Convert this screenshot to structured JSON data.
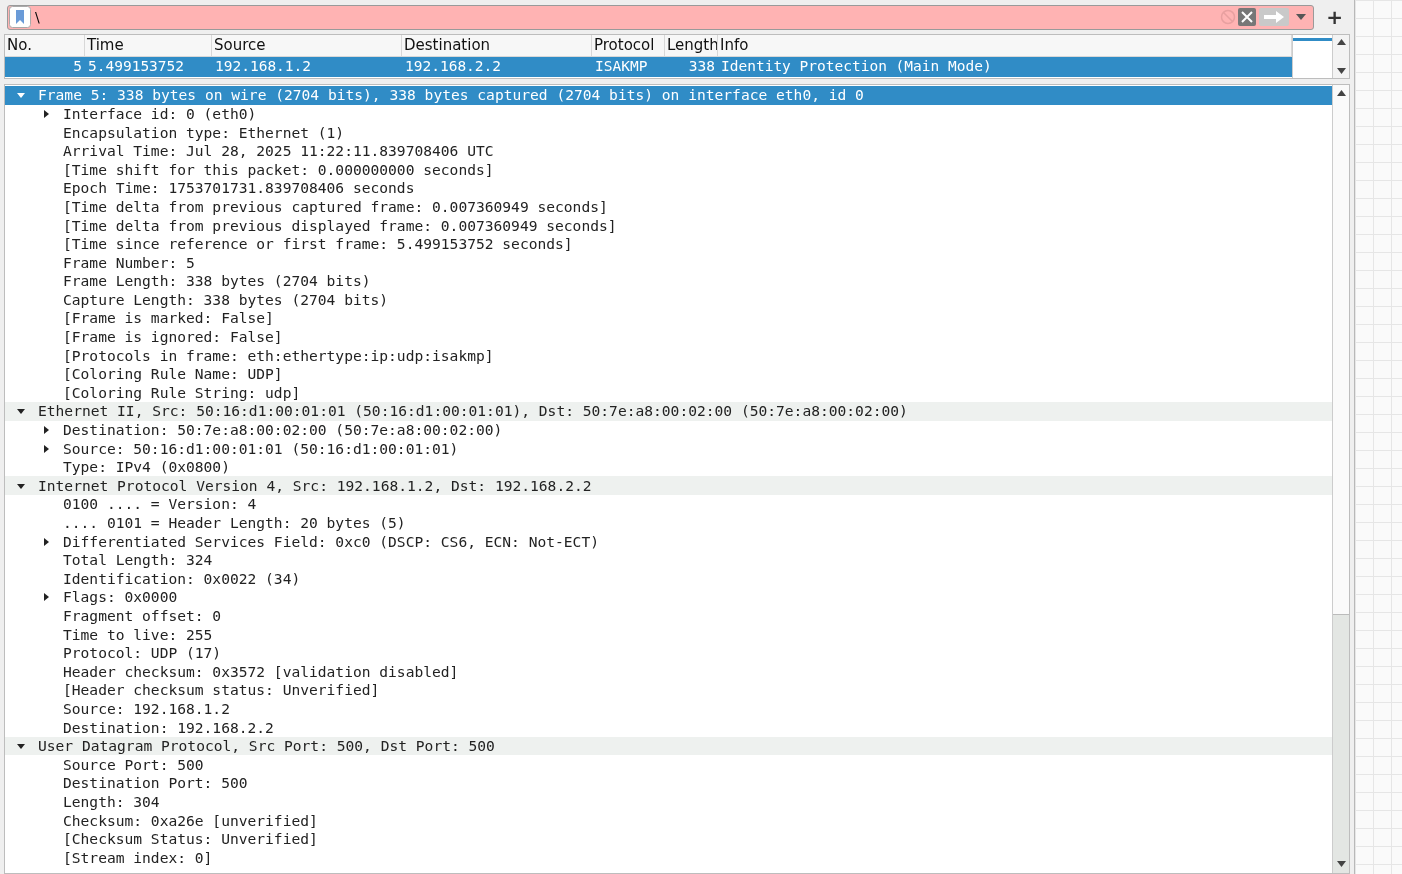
{
  "filter": {
    "value": "\\",
    "invalid": true,
    "plus": "+"
  },
  "packet_list": {
    "columns": [
      "No.",
      "Time",
      "Source",
      "Destination",
      "Protocol",
      "Length",
      "Info"
    ],
    "rows": [
      {
        "selected": true,
        "cells": [
          "5",
          "5.499153752",
          "192.168.1.2",
          "192.168.2.2",
          "ISAKMP",
          "338",
          "Identity Protection (Main Mode)"
        ]
      }
    ]
  },
  "details": [
    {
      "text": "Frame 5: 338 bytes on wire (2704 bits), 338 bytes captured (2704 bits) on interface eth0, id 0",
      "expanded": true,
      "selected": true,
      "children": [
        {
          "text": "Interface id: 0 (eth0)",
          "expanded": false,
          "selected": false
        },
        {
          "text": "Encapsulation type: Ethernet (1)",
          "selected": false
        },
        {
          "text": "Arrival Time: Jul 28, 2025 11:22:11.839708406 UTC",
          "selected": false
        },
        {
          "text": "[Time shift for this packet: 0.000000000 seconds]",
          "selected": false
        },
        {
          "text": "Epoch Time: 1753701731.839708406 seconds",
          "selected": false
        },
        {
          "text": "[Time delta from previous captured frame: 0.007360949 seconds]",
          "selected": false
        },
        {
          "text": "[Time delta from previous displayed frame: 0.007360949 seconds]",
          "selected": false
        },
        {
          "text": "[Time since reference or first frame: 5.499153752 seconds]",
          "selected": false
        },
        {
          "text": "Frame Number: 5",
          "selected": false
        },
        {
          "text": "Frame Length: 338 bytes (2704 bits)",
          "selected": false
        },
        {
          "text": "Capture Length: 338 bytes (2704 bits)",
          "selected": false
        },
        {
          "text": "[Frame is marked: False]",
          "selected": false
        },
        {
          "text": "[Frame is ignored: False]",
          "selected": false
        },
        {
          "text": "[Protocols in frame: eth:ethertype:ip:udp:isakmp]",
          "selected": false
        },
        {
          "text": "[Coloring Rule Name: UDP]",
          "selected": false
        },
        {
          "text": "[Coloring Rule String: udp]",
          "selected": false
        }
      ]
    },
    {
      "text": "Ethernet II, Src: 50:16:d1:00:01:01 (50:16:d1:00:01:01), Dst: 50:7e:a8:00:02:00 (50:7e:a8:00:02:00)",
      "expanded": true,
      "selected": false,
      "children": [
        {
          "text": "Destination: 50:7e:a8:00:02:00 (50:7e:a8:00:02:00)",
          "expanded": false,
          "selected": false
        },
        {
          "text": "Source: 50:16:d1:00:01:01 (50:16:d1:00:01:01)",
          "expanded": false,
          "selected": false
        },
        {
          "text": "Type: IPv4 (0x0800)",
          "selected": false
        }
      ]
    },
    {
      "text": "Internet Protocol Version 4, Src: 192.168.1.2, Dst: 192.168.2.2",
      "expanded": true,
      "selected": false,
      "children": [
        {
          "text": "0100 .... = Version: 4",
          "selected": false
        },
        {
          "text": ".... 0101 = Header Length: 20 bytes (5)",
          "selected": false
        },
        {
          "text": "Differentiated Services Field: 0xc0 (DSCP: CS6, ECN: Not-ECT)",
          "expanded": false,
          "selected": false
        },
        {
          "text": "Total Length: 324",
          "selected": false
        },
        {
          "text": "Identification: 0x0022 (34)",
          "selected": false
        },
        {
          "text": "Flags: 0x0000",
          "expanded": false,
          "selected": false
        },
        {
          "text": "Fragment offset: 0",
          "selected": false
        },
        {
          "text": "Time to live: 255",
          "selected": false
        },
        {
          "text": "Protocol: UDP (17)",
          "selected": false
        },
        {
          "text": "Header checksum: 0x3572 [validation disabled]",
          "selected": false
        },
        {
          "text": "[Header checksum status: Unverified]",
          "selected": false
        },
        {
          "text": "Source: 192.168.1.2",
          "selected": false
        },
        {
          "text": "Destination: 192.168.2.2",
          "selected": false
        }
      ]
    },
    {
      "text": "User Datagram Protocol, Src Port: 500, Dst Port: 500",
      "expanded": true,
      "selected": false,
      "children": [
        {
          "text": "Source Port: 500",
          "selected": false
        },
        {
          "text": "Destination Port: 500",
          "selected": false
        },
        {
          "text": "Length: 304",
          "selected": false
        },
        {
          "text": "Checksum: 0xa26e [unverified]",
          "selected": false
        },
        {
          "text": "[Checksum Status: Unverified]",
          "selected": false
        },
        {
          "text": "[Stream index: 0]",
          "selected": false
        }
      ]
    }
  ]
}
